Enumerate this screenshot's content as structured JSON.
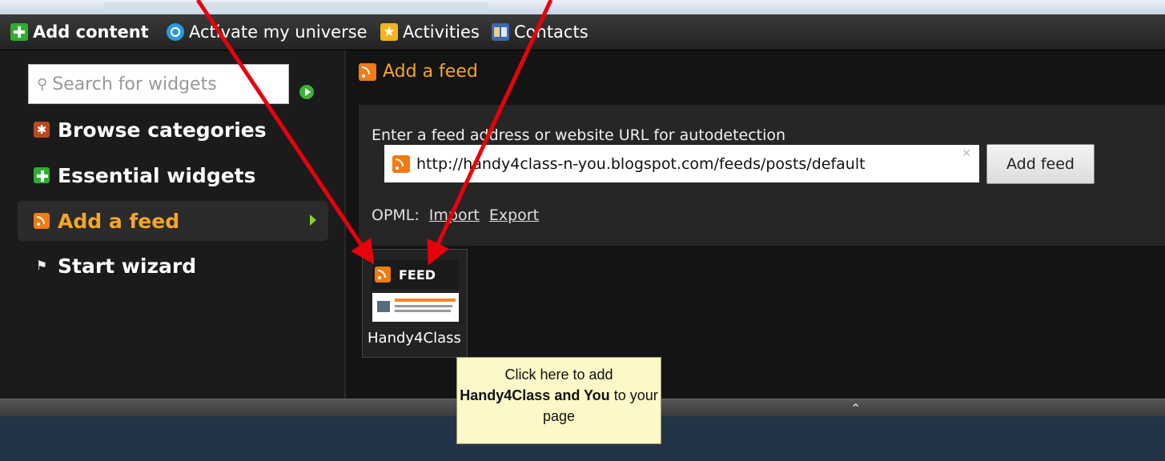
{
  "menu": {
    "items": [
      {
        "label": "Add content",
        "icon": "plus-icon",
        "active": true
      },
      {
        "label": "Activate my universe",
        "icon": "target-icon"
      },
      {
        "label": "Activities",
        "icon": "star-icon"
      },
      {
        "label": "Contacts",
        "icon": "contacts-icon"
      }
    ]
  },
  "sidebar": {
    "search_placeholder": "Search for widgets",
    "items": [
      {
        "label": "Browse categories",
        "icon": "asterisk-icon"
      },
      {
        "label": "Essential widgets",
        "icon": "plus-icon"
      },
      {
        "label": "Add a feed",
        "icon": "rss-icon",
        "selected": true
      },
      {
        "label": "Start wizard",
        "icon": "checkered-flag-icon"
      }
    ]
  },
  "main": {
    "title": "Add a feed",
    "form_label": "Enter a feed address or website URL for autodetection",
    "url_value": "http://handy4class-n-you.blogspot.com/feeds/posts/default",
    "add_button": "Add feed",
    "opml_label": "OPML:",
    "import_link": "Import",
    "export_link": "Export"
  },
  "tile": {
    "header": "FEED",
    "label": "Handy4Class"
  },
  "tooltip": {
    "line1": "Click here to add",
    "bold": "Handy4Class and You",
    "tail": "to your page"
  },
  "colors": {
    "accent": "#f5a623",
    "annotation_arrow": "#e8000a",
    "tooltip_bg": "#fcf8c8"
  }
}
